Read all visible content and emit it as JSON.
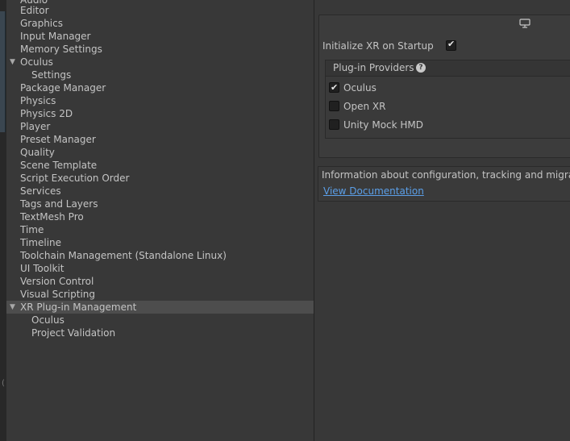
{
  "sidebar": {
    "items": [
      {
        "label": "Audio"
      },
      {
        "label": "Editor"
      },
      {
        "label": "Graphics"
      },
      {
        "label": "Input Manager"
      },
      {
        "label": "Memory Settings"
      },
      {
        "label": "Oculus"
      },
      {
        "label": "Settings"
      },
      {
        "label": "Package Manager"
      },
      {
        "label": "Physics"
      },
      {
        "label": "Physics 2D"
      },
      {
        "label": "Player"
      },
      {
        "label": "Preset Manager"
      },
      {
        "label": "Quality"
      },
      {
        "label": "Scene Template"
      },
      {
        "label": "Script Execution Order"
      },
      {
        "label": "Services"
      },
      {
        "label": "Tags and Layers"
      },
      {
        "label": "TextMesh Pro"
      },
      {
        "label": "Time"
      },
      {
        "label": "Timeline"
      },
      {
        "label": "Toolchain Management (Standalone Linux)"
      },
      {
        "label": "UI Toolkit"
      },
      {
        "label": "Version Control"
      },
      {
        "label": "Visual Scripting"
      },
      {
        "label": "XR Plug-in Management"
      },
      {
        "label": "Oculus"
      },
      {
        "label": "Project Validation"
      }
    ],
    "selected": "XR Plug-in Management"
  },
  "xr": {
    "platform_icon": "monitor-icon",
    "init_label": "Initialize XR on Startup",
    "init_checked": true,
    "providers_title": "Plug-in Providers",
    "providers": [
      {
        "label": "Oculus",
        "checked": true
      },
      {
        "label": "Open XR",
        "checked": false
      },
      {
        "label": "Unity Mock HMD",
        "checked": false
      }
    ],
    "info_text": "Information about configuration, tracking and migration",
    "doc_link": "View Documentation"
  }
}
